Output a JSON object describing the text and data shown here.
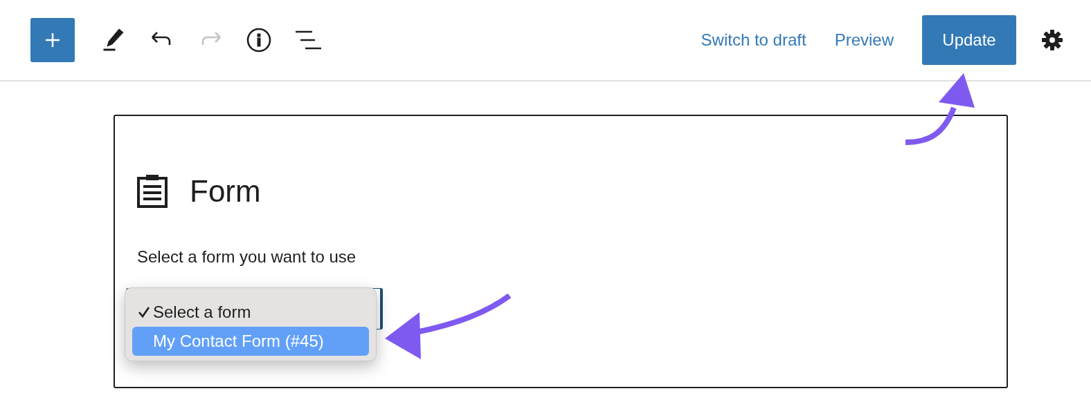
{
  "toolbar": {
    "undo": {
      "disabled": false
    },
    "redo": {
      "disabled": true
    },
    "links": [
      "Switch to draft",
      "Preview"
    ],
    "primary_button": "Update"
  },
  "block": {
    "title": "Form",
    "description": "Select a form you want to use",
    "dropdown": {
      "open": true,
      "options": [
        {
          "label": "Select a form",
          "checked": true,
          "selected": false
        },
        {
          "label": "My Contact Form (#45)",
          "checked": false,
          "selected": true
        }
      ]
    }
  }
}
